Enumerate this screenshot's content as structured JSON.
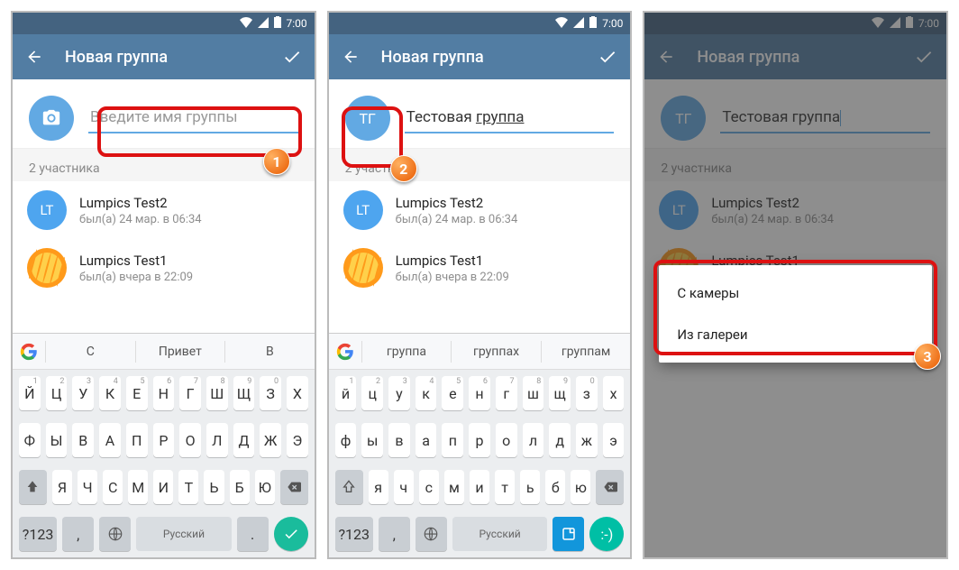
{
  "status": {
    "time": "7:00"
  },
  "header": {
    "title": "Новая группа"
  },
  "screen1": {
    "placeholder": "Введите имя группы",
    "section": "2 участника",
    "suggest": [
      "С",
      "Привет",
      "В"
    ]
  },
  "screen2": {
    "avatar_initials": "ТГ",
    "name_plain": "Тестовая ",
    "name_underlined": "группа",
    "section": "2 участника",
    "suggest": [
      "группа",
      "группах",
      "группам"
    ]
  },
  "screen3": {
    "avatar_initials": "ТГ",
    "name": "Тестовая группа",
    "section": "2 участника",
    "menu": {
      "camera": "С камеры",
      "gallery": "Из галереи"
    }
  },
  "members": [
    {
      "initials": "LT",
      "name": "Lumpics Test2",
      "status": "был(а) 24 мар. в 06:34"
    },
    {
      "name": "Lumpics Test1",
      "status": "был(а) вчера в 22:09"
    }
  ],
  "kb": {
    "row1": [
      "Й",
      "Ц",
      "У",
      "К",
      "Е",
      "Н",
      "Г",
      "Ш",
      "Щ",
      "З",
      "Х"
    ],
    "row1_lc": [
      "й",
      "ц",
      "у",
      "к",
      "е",
      "н",
      "г",
      "ш",
      "щ",
      "з",
      "х"
    ],
    "hints": [
      "1",
      "2",
      "3",
      "4",
      "5",
      "6",
      "7",
      "8",
      "9",
      "0",
      ""
    ],
    "row2": [
      "Ф",
      "Ы",
      "В",
      "А",
      "П",
      "Р",
      "О",
      "Л",
      "Д",
      "Ж",
      "Э"
    ],
    "row2_lc": [
      "ф",
      "ы",
      "в",
      "а",
      "п",
      "р",
      "о",
      "л",
      "д",
      "ж",
      "э"
    ],
    "row3": [
      "Я",
      "Ч",
      "С",
      "М",
      "И",
      "Т",
      "Ь",
      "Б",
      "Ю"
    ],
    "row3_lc": [
      "я",
      "ч",
      "с",
      "м",
      "и",
      "т",
      "ь",
      "б",
      "ю"
    ],
    "sym": "?123",
    "space": "Русский",
    "comma": ",",
    "dot": "."
  },
  "badges": {
    "b1": "1",
    "b2": "2",
    "b3": "3"
  }
}
